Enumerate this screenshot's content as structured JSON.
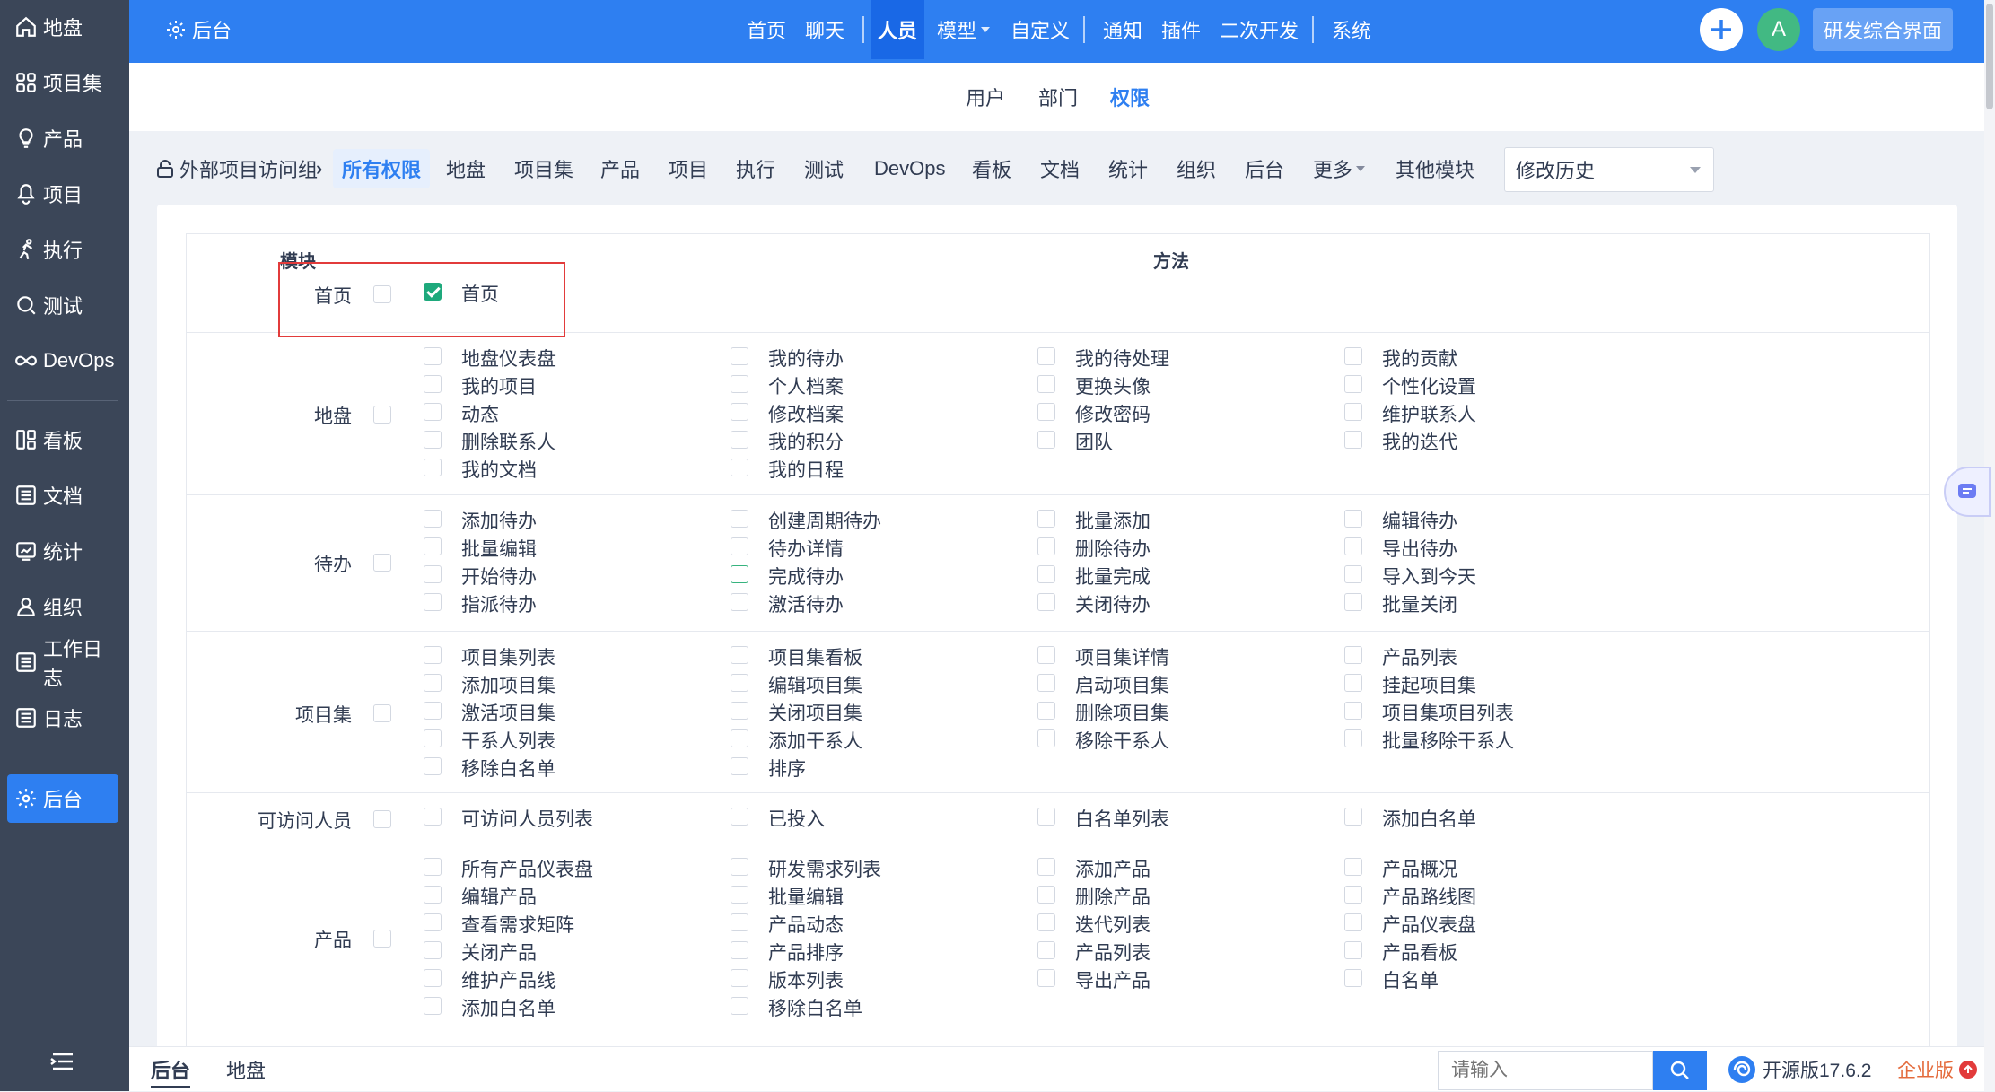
{
  "sidebar": {
    "items": [
      {
        "label": "地盘",
        "icon": "home-icon"
      },
      {
        "label": "项目集",
        "icon": "grid-icon"
      },
      {
        "label": "产品",
        "icon": "bulb-icon"
      },
      {
        "label": "项目",
        "icon": "project-icon"
      },
      {
        "label": "执行",
        "icon": "run-icon"
      },
      {
        "label": "测试",
        "icon": "search-icon"
      },
      {
        "label": "DevOps",
        "icon": "infinity-icon"
      },
      {
        "label": "看板",
        "icon": "kanban-icon"
      },
      {
        "label": "文档",
        "icon": "doc-icon"
      },
      {
        "label": "统计",
        "icon": "stats-icon"
      },
      {
        "label": "组织",
        "icon": "user-icon"
      },
      {
        "label": "工作日志",
        "icon": "doc-icon"
      },
      {
        "label": "日志",
        "icon": "doc-icon"
      },
      {
        "label": "后台",
        "icon": "gear-icon"
      }
    ],
    "active_label": "后台"
  },
  "topbar": {
    "back_label": "后台",
    "nav": [
      "首页",
      "聊天",
      "人员",
      "模型",
      "自定义",
      "通知",
      "插件",
      "二次开发",
      "系统"
    ],
    "active": "人员",
    "avatar_letter": "A",
    "app_button": "研发综合界面"
  },
  "subnav": {
    "tabs": [
      "用户",
      "部门",
      "权限"
    ],
    "active": "权限"
  },
  "toolbar": {
    "breadcrumb": "外部项目访问组",
    "items": [
      "所有权限",
      "地盘",
      "项目集",
      "产品",
      "项目",
      "执行",
      "测试",
      "DevOps",
      "看板",
      "文档",
      "统计",
      "组织",
      "后台",
      "更多",
      "其他模块"
    ],
    "active": "所有权限",
    "history": "修改历史"
  },
  "table": {
    "header_module": "模块",
    "header_method": "方法",
    "rows": [
      {
        "module": "首页",
        "methods": [
          {
            "label": "首页",
            "checked": true
          }
        ]
      },
      {
        "module": "地盘",
        "methods": [
          {
            "label": "地盘仪表盘"
          },
          {
            "label": "我的待办"
          },
          {
            "label": "我的待处理"
          },
          {
            "label": "我的贡献"
          },
          {
            "label": "我的项目"
          },
          {
            "label": "个人档案"
          },
          {
            "label": "更换头像"
          },
          {
            "label": "个性化设置"
          },
          {
            "label": "动态"
          },
          {
            "label": "修改档案"
          },
          {
            "label": "修改密码"
          },
          {
            "label": "维护联系人"
          },
          {
            "label": "删除联系人"
          },
          {
            "label": "我的积分"
          },
          {
            "label": "团队"
          },
          {
            "label": "我的迭代"
          },
          {
            "label": "我的文档"
          },
          {
            "label": "我的日程"
          }
        ]
      },
      {
        "module": "待办",
        "methods": [
          {
            "label": "添加待办"
          },
          {
            "label": "创建周期待办"
          },
          {
            "label": "批量添加"
          },
          {
            "label": "编辑待办"
          },
          {
            "label": "批量编辑"
          },
          {
            "label": "待办详情"
          },
          {
            "label": "删除待办"
          },
          {
            "label": "导出待办"
          },
          {
            "label": "开始待办"
          },
          {
            "label": "完成待办",
            "highlight": true
          },
          {
            "label": "批量完成"
          },
          {
            "label": "导入到今天"
          },
          {
            "label": "指派待办"
          },
          {
            "label": "激活待办"
          },
          {
            "label": "关闭待办"
          },
          {
            "label": "批量关闭"
          }
        ]
      },
      {
        "module": "项目集",
        "methods": [
          {
            "label": "项目集列表"
          },
          {
            "label": "项目集看板"
          },
          {
            "label": "项目集详情"
          },
          {
            "label": "产品列表"
          },
          {
            "label": "添加项目集"
          },
          {
            "label": "编辑项目集"
          },
          {
            "label": "启动项目集"
          },
          {
            "label": "挂起项目集"
          },
          {
            "label": "激活项目集"
          },
          {
            "label": "关闭项目集"
          },
          {
            "label": "删除项目集"
          },
          {
            "label": "项目集项目列表"
          },
          {
            "label": "干系人列表"
          },
          {
            "label": "添加干系人"
          },
          {
            "label": "移除干系人"
          },
          {
            "label": "批量移除干系人"
          },
          {
            "label": "移除白名单"
          },
          {
            "label": "排序"
          }
        ]
      },
      {
        "module": "可访问人员",
        "methods": [
          {
            "label": "可访问人员列表"
          },
          {
            "label": "已投入"
          },
          {
            "label": "白名单列表"
          },
          {
            "label": "添加白名单"
          }
        ]
      },
      {
        "module": "产品",
        "methods": [
          {
            "label": "所有产品仪表盘"
          },
          {
            "label": "研发需求列表"
          },
          {
            "label": "添加产品"
          },
          {
            "label": "产品概况"
          },
          {
            "label": "编辑产品"
          },
          {
            "label": "批量编辑"
          },
          {
            "label": "删除产品"
          },
          {
            "label": "产品路线图"
          },
          {
            "label": "查看需求矩阵"
          },
          {
            "label": "产品动态"
          },
          {
            "label": "迭代列表"
          },
          {
            "label": "产品仪表盘"
          },
          {
            "label": "关闭产品"
          },
          {
            "label": "产品排序"
          },
          {
            "label": "产品列表"
          },
          {
            "label": "产品看板"
          },
          {
            "label": "维护产品线"
          },
          {
            "label": "版本列表"
          },
          {
            "label": "导出产品"
          },
          {
            "label": "白名单"
          },
          {
            "label": "添加白名单"
          },
          {
            "label": "移除白名单"
          }
        ]
      }
    ]
  },
  "bottombar": {
    "tabs": [
      "后台",
      "地盘"
    ],
    "active": "后台",
    "search_placeholder": "请输入",
    "version": "开源版17.6.2",
    "edition": "企业版"
  },
  "colors": {
    "primary": "#2e7ff1",
    "sidebar": "#3b4658",
    "check": "#1ea97c",
    "highlight_box": "#e23b3b"
  }
}
